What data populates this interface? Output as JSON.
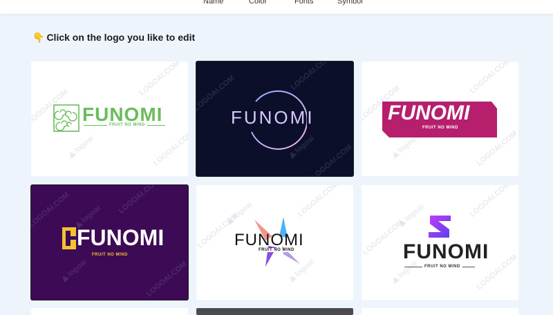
{
  "tabs": [
    "Name",
    "Color",
    "Fonts",
    "Symbol"
  ],
  "heading": {
    "emoji": "👇",
    "text": "Click on the logo you like to edit"
  },
  "watermark": {
    "brand": "logoai",
    "domain": "LOGOAI.COM"
  },
  "logos": [
    {
      "name": "FUNOMI",
      "tagline": "FRUIT NO MIND",
      "bg": "#ffffff",
      "color": "#6bbd5b",
      "icon": "swirl-square-icon"
    },
    {
      "name": "FUNOMI",
      "bg": "#0c0f2a",
      "color": "#d9c9ff",
      "icon": "circle-ring-icon"
    },
    {
      "name": "FUNOMI",
      "tagline": "FRUIT NO MIND",
      "bg": "#ffffff",
      "color": "#b51f6b",
      "icon": "banner-shape-icon"
    },
    {
      "name": "FUNOMI",
      "tagline": "FRUIT NO MIND",
      "bg": "#3d0b56",
      "color": "#ffffff",
      "accent": "#f2c230",
      "icon": "f-block-icon"
    },
    {
      "name": "FUNOMI",
      "tagline": "FRUIT NO MIND",
      "bg": "#ffffff",
      "color": "#111111",
      "accent": "#8c4de0",
      "icon": "star-burst-icon"
    },
    {
      "name": "FUNOMI",
      "tagline": "FRUIT NO MIND",
      "bg": "#ffffff",
      "color": "#222222",
      "accent": "#8e3ff0",
      "icon": "s-arrow-icon"
    }
  ]
}
